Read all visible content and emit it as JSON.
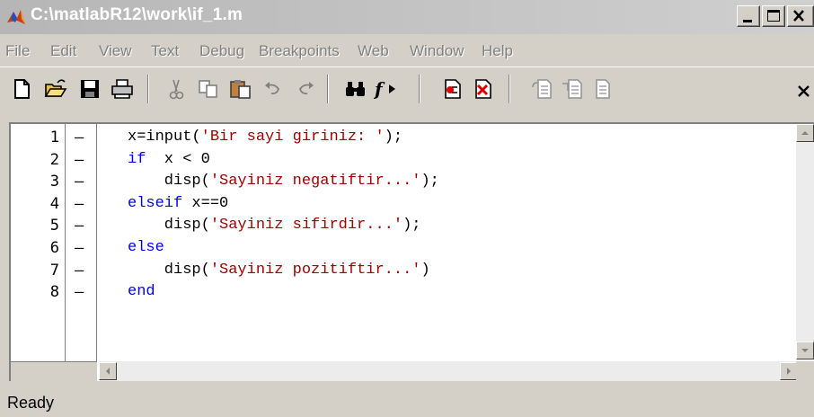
{
  "window": {
    "title": "C:\\matlabR12\\work\\if_1.m"
  },
  "menu": [
    "File",
    "Edit",
    "View",
    "Text",
    "Debug",
    "Breakpoints",
    "Web",
    "Window",
    "Help"
  ],
  "toolbar": {
    "icons": [
      "new-file-icon",
      "open-folder-icon",
      "save-icon",
      "print-icon",
      "cut-icon",
      "copy-icon",
      "paste-icon",
      "undo-icon",
      "redo-icon",
      "find-icon",
      "function-icon",
      "set-breakpoint-icon",
      "clear-breakpoint-icon",
      "step-icon",
      "step-in-icon",
      "step-out-icon",
      "exit-debug-icon"
    ]
  },
  "editor": {
    "line_numbers": [
      "1",
      "2",
      "3",
      "4",
      "5",
      "6",
      "7",
      "8"
    ],
    "line_marker": "–",
    "lines": [
      [
        {
          "t": "tx",
          "v": "x=input("
        },
        {
          "t": "str",
          "v": "'Bir sayi giriniz: '"
        },
        {
          "t": "tx",
          "v": ");"
        }
      ],
      [
        {
          "t": "kw",
          "v": "if"
        },
        {
          "t": "tx",
          "v": "  x < 0"
        }
      ],
      [
        {
          "t": "tx",
          "v": "    disp("
        },
        {
          "t": "str",
          "v": "'Sayiniz negatiftir...'"
        },
        {
          "t": "tx",
          "v": ");"
        }
      ],
      [
        {
          "t": "kw",
          "v": "elseif"
        },
        {
          "t": "tx",
          "v": " x==0"
        }
      ],
      [
        {
          "t": "tx",
          "v": "    disp("
        },
        {
          "t": "str",
          "v": "'Sayiniz sifirdir...'"
        },
        {
          "t": "tx",
          "v": ");"
        }
      ],
      [
        {
          "t": "kw",
          "v": "else"
        }
      ],
      [
        {
          "t": "tx",
          "v": "    disp("
        },
        {
          "t": "str",
          "v": "'Sayiniz pozitiftir...'"
        },
        {
          "t": "tx",
          "v": ")"
        }
      ],
      [
        {
          "t": "kw",
          "v": "end"
        }
      ]
    ]
  },
  "status": {
    "text": "Ready"
  },
  "colors": {
    "keyword": "#0000ff",
    "string": "#a00000",
    "title_text": "#ffffff"
  }
}
